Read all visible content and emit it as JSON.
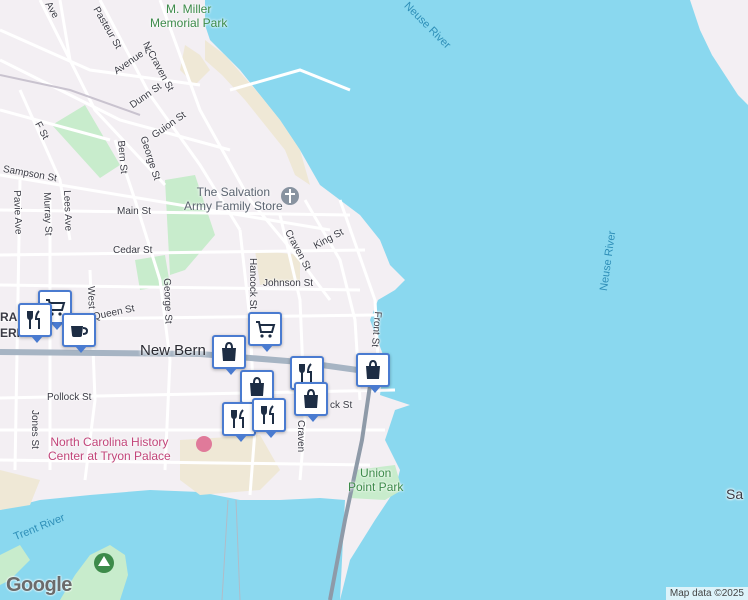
{
  "map": {
    "street_labels": [
      {
        "id": "pasteur",
        "text": "Pasteur St"
      },
      {
        "id": "avenue-a",
        "text": "Avenue A"
      },
      {
        "id": "n-craven",
        "text": "N Craven St"
      },
      {
        "id": "dunn",
        "text": "Dunn St"
      },
      {
        "id": "guion",
        "text": "Guion St"
      },
      {
        "id": "f-st",
        "text": "F St"
      },
      {
        "id": "bern",
        "text": "Bern St"
      },
      {
        "id": "george-upper",
        "text": "George St"
      },
      {
        "id": "sampson",
        "text": "Sampson St"
      },
      {
        "id": "lees",
        "text": "Lees Ave"
      },
      {
        "id": "murray",
        "text": "Murray St"
      },
      {
        "id": "pavie",
        "text": "Pavie Ave"
      },
      {
        "id": "main",
        "text": "Main St"
      },
      {
        "id": "cedar",
        "text": "Cedar St"
      },
      {
        "id": "craven",
        "text": "Craven St"
      },
      {
        "id": "king",
        "text": "King St"
      },
      {
        "id": "hancock",
        "text": "Hancock St"
      },
      {
        "id": "johnson",
        "text": "Johnson St"
      },
      {
        "id": "george-lower",
        "text": "George St"
      },
      {
        "id": "queen",
        "text": "Queen St"
      },
      {
        "id": "west",
        "text": "West"
      },
      {
        "id": "front",
        "text": "Front St"
      },
      {
        "id": "pollock",
        "text": "Pollock St"
      },
      {
        "id": "jones",
        "text": "Jones St"
      },
      {
        "id": "craven-lower",
        "text": "Craven"
      },
      {
        "id": "pollock-right",
        "text": "ck St"
      },
      {
        "id": "ave",
        "text": "Ave"
      }
    ],
    "big_road": "New Bern",
    "poi": {
      "miller_park": "M. Miller\nMemorial Park",
      "salvation_army": "The Salvation\nArmy Family Store",
      "history_center": "North Carolina History\nCenter at Tryon Palace",
      "union_point": "Union\nPoint Park"
    },
    "water_labels": {
      "neuse_top": "Neuse River",
      "neuse_mid": "Neuse River",
      "trent": "Trent River",
      "partial_right": "Sa"
    },
    "left_edge_text": "ERR",
    "left_edge_text2": "RA",
    "markers": [
      {
        "id": "m1",
        "icon": "shopping-cart-icon"
      },
      {
        "id": "m2",
        "icon": "restaurant-icon"
      },
      {
        "id": "m3",
        "icon": "coffee-icon"
      },
      {
        "id": "m4",
        "icon": "shopping-bag-icon"
      },
      {
        "id": "m5",
        "icon": "restaurant-icon"
      },
      {
        "id": "m6",
        "icon": "shopping-bag-icon"
      },
      {
        "id": "m7",
        "icon": "restaurant-icon"
      },
      {
        "id": "m8",
        "icon": "restaurant-icon"
      },
      {
        "id": "m9",
        "icon": "shopping-bag-icon"
      }
    ],
    "logo": "Google",
    "attribution": "Map data ©2025",
    "colors": {
      "water": "#8ad8ef",
      "land": "#f3eff3",
      "park": "#c8eccc",
      "marker_border": "#4a7bd0",
      "marker_icon": "#1d2d44"
    }
  }
}
